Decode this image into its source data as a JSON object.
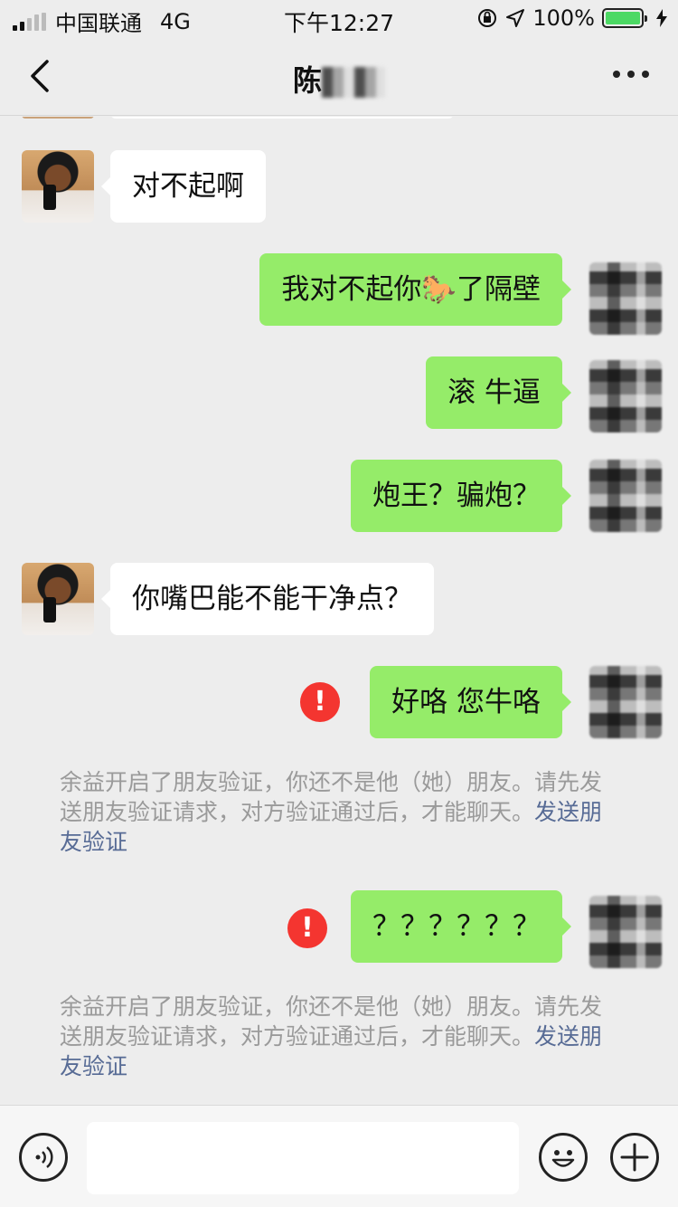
{
  "status_bar": {
    "carrier": "中国联通",
    "network": "4G",
    "time": "下午12:27",
    "battery": "100%"
  },
  "nav": {
    "title": "陈"
  },
  "messages": [
    {
      "side": "in",
      "text": "对不起啊"
    },
    {
      "side": "out",
      "text": "我对不起你🐎了隔壁"
    },
    {
      "side": "out",
      "text": "滚 牛逼"
    },
    {
      "side": "out",
      "text": "炮王？骗炮？"
    },
    {
      "side": "in",
      "text": "你嘴巴能不能干净点？"
    },
    {
      "side": "out",
      "text": "好咯 您牛咯",
      "failed": true
    },
    {
      "side": "out",
      "text": "？？？？？？",
      "failed": true
    }
  ],
  "system_messages": [
    {
      "text": "余益开启了朋友验证，你还不是他（她）朋友。请先发送朋友验证请求，对方验证通过后，才能聊天。",
      "link": "发送朋友验证"
    },
    {
      "text": "余益开启了朋友验证，你还不是他（她）朋友。请先发送朋友验证请求，对方验证通过后，才能聊天。",
      "link": "发送朋友验证"
    }
  ],
  "icons": {
    "failed": "!"
  },
  "colors": {
    "outgoing_bubble": "#95ec69",
    "incoming_bubble": "#ffffff",
    "error": "#f43530",
    "link": "#576b95"
  }
}
